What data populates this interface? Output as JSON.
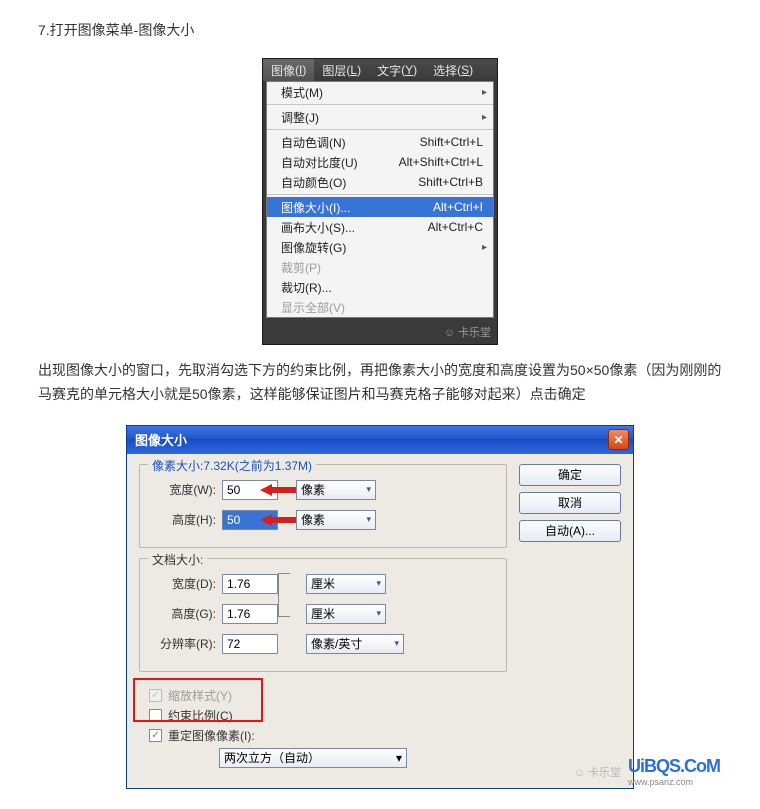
{
  "step_title": "7.打开图像菜单-图像大小",
  "menubar": [
    {
      "label": "图像",
      "key": "I",
      "active": true
    },
    {
      "label": "图层",
      "key": "L",
      "active": false
    },
    {
      "label": "文字",
      "key": "Y",
      "active": false
    },
    {
      "label": "选择",
      "key": "S",
      "active": false
    }
  ],
  "menu_items": [
    {
      "label": "模式(M)",
      "shortcut": "",
      "sub": true,
      "type": "item"
    },
    {
      "type": "sep"
    },
    {
      "label": "调整(J)",
      "shortcut": "",
      "sub": true,
      "type": "item"
    },
    {
      "type": "sep"
    },
    {
      "label": "自动色调(N)",
      "shortcut": "Shift+Ctrl+L",
      "type": "item"
    },
    {
      "label": "自动对比度(U)",
      "shortcut": "Alt+Shift+Ctrl+L",
      "type": "item"
    },
    {
      "label": "自动颜色(O)",
      "shortcut": "Shift+Ctrl+B",
      "type": "item"
    },
    {
      "type": "sep"
    },
    {
      "label": "图像大小(I)...",
      "shortcut": "Alt+Ctrl+I",
      "selected": true,
      "type": "item"
    },
    {
      "label": "画布大小(S)...",
      "shortcut": "Alt+Ctrl+C",
      "type": "item"
    },
    {
      "label": "图像旋转(G)",
      "shortcut": "",
      "sub": true,
      "type": "item"
    },
    {
      "label": "裁剪(P)",
      "shortcut": "",
      "disabled": true,
      "type": "item"
    },
    {
      "label": "裁切(R)...",
      "shortcut": "",
      "type": "item"
    },
    {
      "label": "显示全部(V)",
      "shortcut": "",
      "disabled": true,
      "type": "item"
    }
  ],
  "watermark_menu": "卡乐堂",
  "paragraph": "出现图像大小的窗口，先取消勾选下方的约束比例，再把像素大小的宽度和高度设置为50×50像素（因为刚刚的马赛克的单元格大小就是50像素，这样能够保证图片和马赛克格子能够对起来）点击确定",
  "dialog": {
    "title": "图像大小",
    "buttons": {
      "ok": "确定",
      "cancel": "取消",
      "auto": "自动(A)..."
    },
    "pixel_group": {
      "title": "像素大小:7.32K(之前为1.37M)",
      "width_label": "宽度(W):",
      "width_val": "50",
      "height_label": "高度(H):",
      "height_val": "50",
      "unit": "像素"
    },
    "doc_group": {
      "title": "文档大小:",
      "width_label": "宽度(D):",
      "width_val": "1.76",
      "width_unit": "厘米",
      "height_label": "高度(G):",
      "height_val": "1.76",
      "height_unit": "厘米",
      "res_label": "分辨率(R):",
      "res_val": "72",
      "res_unit": "像素/英寸"
    },
    "checks": {
      "scale_styles": "缩放样式(Y)",
      "constrain": "约束比例(C)",
      "resample": "重定图像像素(I):"
    },
    "interp": "两次立方（自动）"
  },
  "watermark_dlg": "卡乐堂",
  "watermark_site": "UiBQS.CoM",
  "watermark_site_sub": "www.psanz.com"
}
